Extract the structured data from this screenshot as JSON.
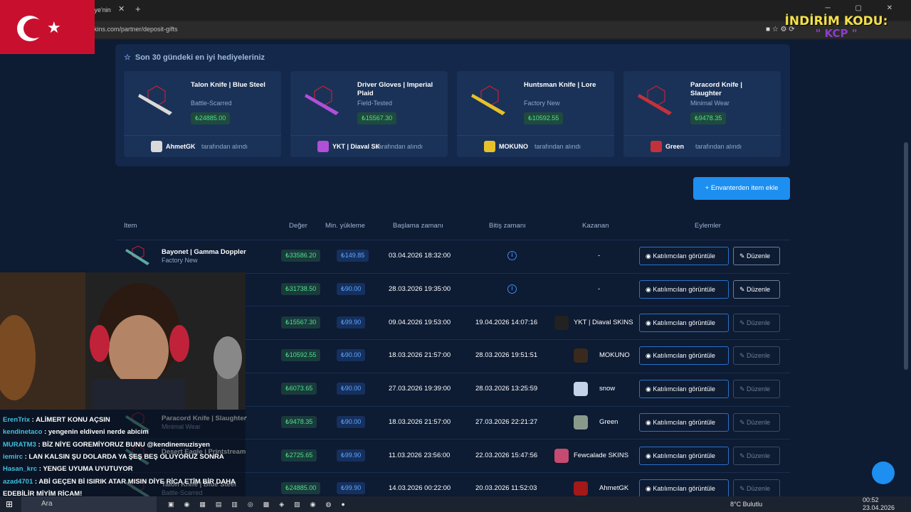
{
  "browser": {
    "tab_title": "kye'nin",
    "url": "kins.com/partner/deposit-gifts",
    "promo_title": "İNDİRİM KODU:",
    "promo_code": "\" KCP \""
  },
  "gifts_panel": {
    "title": "Son 30 gündeki en iyi hediyeleriniz",
    "by_text": "tarafından alındı",
    "items": [
      {
        "name": "Talon Knife | Blue Steel",
        "condition": "Battle-Scarred",
        "price": "₺24885.00",
        "winner": "AhmetGK"
      },
      {
        "name": "Driver Gloves | Imperial Plaid",
        "condition": "Field-Tested",
        "price": "₺15567.30",
        "winner": "YKT | Diaval SK"
      },
      {
        "name": "Huntsman Knife | Lore",
        "condition": "Factory New",
        "price": "₺10592.55",
        "winner": "MOKUNO"
      },
      {
        "name": "Paracord Knife | Slaughter",
        "condition": "Minimal Wear",
        "price": "₺9478.35",
        "winner": "Green"
      }
    ]
  },
  "add_button": "+ Envanterden item ekle",
  "table": {
    "headers": {
      "item": "Item",
      "value": "Değer",
      "min": "Min. yükleme",
      "start": "Başlama zamanı",
      "end": "Bitiş zamanı",
      "winner": "Kazanan",
      "actions": "Eylemler"
    },
    "view_label": "Katılımcıları görüntüle",
    "edit_label": "Düzenle",
    "rows": [
      {
        "name": "Bayonet | Gamma Doppler",
        "cond": "Factory New",
        "value": "₺33586.20",
        "min": "₺149.85",
        "start": "03.04.2026 18:32:00",
        "end": "",
        "winner": "-"
      },
      {
        "name": "ppler",
        "cond": "",
        "value": "₺31738.50",
        "min": "₺90.00",
        "start": "28.03.2026 19:35:00",
        "end": "",
        "winner": "-"
      },
      {
        "name": "Plaid",
        "cond": "",
        "value": "₺15567.30",
        "min": "₺99.90",
        "start": "09.04.2026 19:53:00",
        "end": "19.04.2026 14:07:16",
        "winner": "YKT | Diaval SKINS"
      },
      {
        "name": "",
        "cond": "",
        "value": "₺10592.55",
        "min": "₺90.00",
        "start": "18.03.2026 21:57:00",
        "end": "28.03.2026 19:51:51",
        "winner": "MOKUNO"
      },
      {
        "name": "e Red",
        "cond": "",
        "value": "₺6073.65",
        "min": "₺90.00",
        "start": "27.03.2026 19:39:00",
        "end": "28.03.2026 13:25:59",
        "winner": "snow"
      },
      {
        "name": "Paracord Knife | Slaughter",
        "cond": "Minimal Wear",
        "value": "₺9478.35",
        "min": "₺90.00",
        "start": "18.03.2026 21:57:00",
        "end": "27.03.2026 22:21:27",
        "winner": "Green"
      },
      {
        "name": "Desert Eagle | Printstream",
        "cond": "",
        "value": "₺2725.65",
        "min": "₺99.90",
        "start": "11.03.2026 23:56:00",
        "end": "22.03.2026 15:47:56",
        "winner": "Fewcalade SKINS"
      },
      {
        "name": "Talon Knife | Blue Steel",
        "cond": "Battle-Scarred",
        "value": "₺24885.00",
        "min": "₺99.90",
        "start": "14.03.2026 00:22:00",
        "end": "20.03.2026 11:52:03",
        "winner": "AhmetGK"
      }
    ]
  },
  "chat": [
    {
      "user": "ErenTrix",
      "msg": ": ALİMERT KONU AÇSIN"
    },
    {
      "user": "kendinetaco",
      "msg": ": yengenin eldiveni nerde abicim"
    },
    {
      "user": "MURATM3",
      "msg": ": BİZ NİYE GOREMİYORUZ BUNU @kendinemuzisyen"
    },
    {
      "user": "iemirc",
      "msg": ": LAN KALSIN ŞU DOLARDA YA ŞEŞ BEŞ OLUYORUZ SONRA"
    },
    {
      "user": "Hasan_krc",
      "msg": ": YENGE UYUMA UYUTUYOR"
    },
    {
      "user": "azad4701",
      "msg": ": ABİ GEÇEN Bİ ISIRIK ATAR MISIN DİYE RİCA ETİM BİR DAHA"
    },
    {
      "user": "",
      "msg": "EDEBİLİR MİYİM RİCAM!"
    }
  ],
  "taskbar": {
    "search": "Ara",
    "weather": "8°C Bulutlu",
    "time": "00:52",
    "date": "23.04.2026"
  },
  "colors": {
    "accent": "#1d8ff0",
    "price": "#4ee08d",
    "bg": "#0d1b33"
  }
}
